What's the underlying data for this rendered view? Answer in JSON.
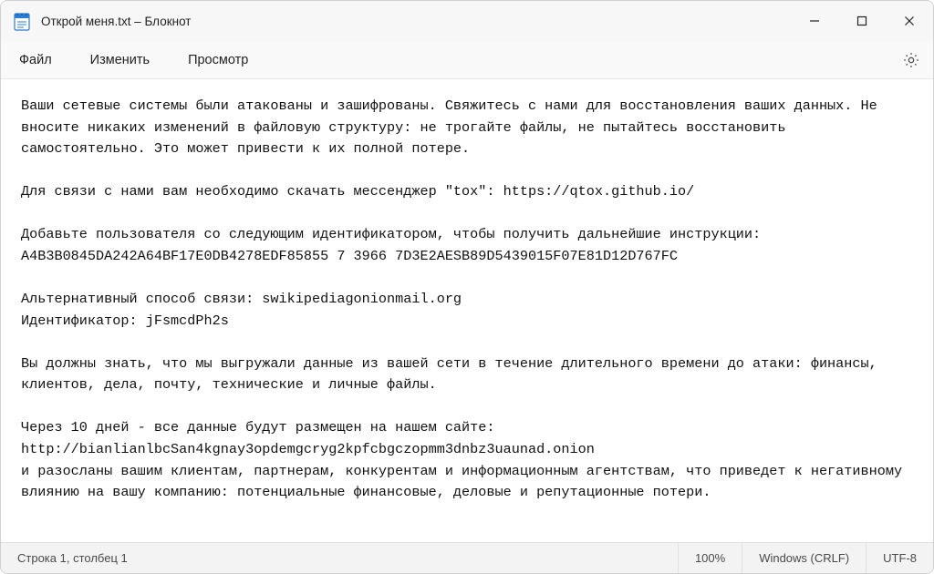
{
  "titlebar": {
    "title": "Открой меня.txt – Блокнот"
  },
  "window_controls": {
    "minimize": "–",
    "maximize": "□",
    "close": "×"
  },
  "menubar": {
    "file": "Файл",
    "edit": "Изменить",
    "view": "Просмотр"
  },
  "content": {
    "text": "Ваши сетевые системы были атакованы и зашифрованы. Свяжитесь с нами для восстановления ваших данных. Не вносите никаких изменений в файловую структуру: не трогайте файлы, не пытайтесь восстановить самостоятельно. Это может привести к их полной потере.\n\nДля связи с нами вам необходимо скачать мессенджер \"tox\": https://qtox.github.io/\n\nДобавьте пользователя со следующим идентификатором, чтобы получить дальнейшие инструкции:\nA4B3B0845DA242A64BF17E0DB4278EDF85855 7 3966 7D3E2AESB89D5439015F07E81D12D767FC\n\nАльтернативный способ связи: swikipediagonionmail.org\nИдентификатор: jFsmcdPh2s\n\nВы должны знать, что мы выгружали данные из вашей сети в течение длительного времени до атаки: финансы, клиентов, дела, почту, технические и личные файлы.\n\nЧерез 10 дней - все данные будут размещен на нашем сайте:\nhttp://bianlianlbcSan4kgnay3opdemgcryg2kpfcbgczopmm3dnbz3uaunad.onion\nи разосланы вашим клиентам, партнерам, конкурентам и информационным агентствам, что приведет к негативному влиянию на вашу компанию: потенциальные финансовые, деловые и репутационные потери."
  },
  "statusbar": {
    "position": "Строка 1, столбец 1",
    "zoom": "100%",
    "line_ending": "Windows (CRLF)",
    "encoding": "UTF-8"
  }
}
